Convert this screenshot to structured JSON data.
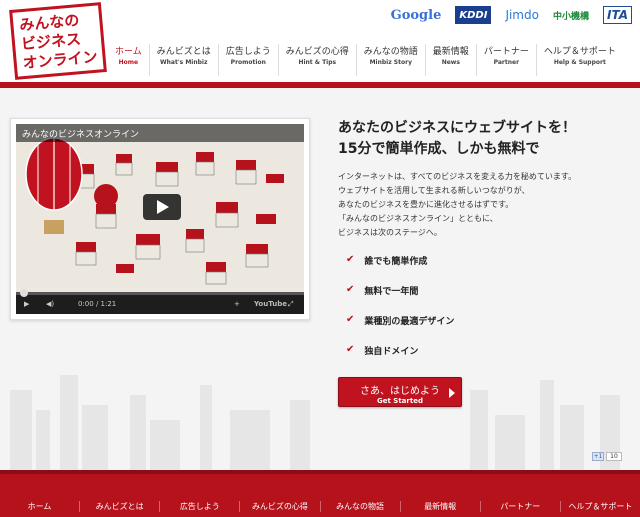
{
  "logo": {
    "line1": "みんなの",
    "line2": "ビジネス",
    "line3": "オンライン"
  },
  "partners": [
    "Google",
    "KDDI",
    "Jimdo",
    "中小機構",
    "ITA"
  ],
  "nav": [
    {
      "jp": "ホーム",
      "en": "Home"
    },
    {
      "jp": "みんビズとは",
      "en": "What's Minbiz"
    },
    {
      "jp": "広告しよう",
      "en": "Promotion"
    },
    {
      "jp": "みんビズの心得",
      "en": "Hint & Tips"
    },
    {
      "jp": "みんなの物語",
      "en": "Minbiz Story"
    },
    {
      "jp": "最新情報",
      "en": "News"
    },
    {
      "jp": "パートナー",
      "en": "Partner"
    },
    {
      "jp": "ヘルプ＆サポート",
      "en": "Help & Support"
    }
  ],
  "video": {
    "title": "みんなのビジネスオンライン",
    "time": "0:00 / 1:21",
    "brand": "YouTube"
  },
  "headline": {
    "line1": "あなたのビジネスにウェブサイトを！",
    "line2": "15分で簡単作成、しかも無料で"
  },
  "intro": [
    "インターネットは、すべてのビジネスを変える力を秘めています。",
    "ウェブサイトを活用して生まれる新しいつながりが、",
    "あなたのビジネスを豊かに進化させるはずです。",
    "「みんなのビジネスオンライン」とともに、",
    "ビジネスは次のステージへ。"
  ],
  "features": [
    "誰でも簡単作成",
    "無料で一年間",
    "業種別の最適デザイン",
    "独自ドメイン"
  ],
  "cta": {
    "jp": "さあ、はじめよう",
    "en": "Get Started"
  },
  "like": {
    "count": "10"
  },
  "footer_nav": [
    "ホーム",
    "みんビズとは",
    "広告しよう",
    "みんビズの心得",
    "みんなの物語",
    "最新情報",
    "パートナー",
    "ヘルプ＆サポート"
  ],
  "colors": {
    "brand_red": "#b5121b",
    "background": "#f4f4f4"
  }
}
